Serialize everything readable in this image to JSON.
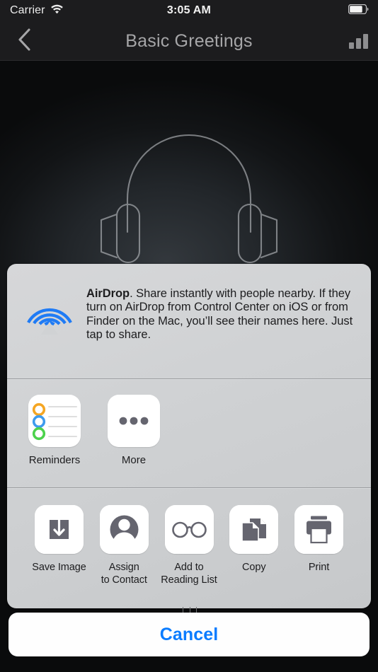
{
  "status_bar": {
    "carrier": "Carrier",
    "wifi_icon": "wifi-icon",
    "time": "3:05 AM",
    "battery_icon": "battery-icon",
    "battery_level_percent": 78
  },
  "nav_bar": {
    "back_icon": "chevron-left-icon",
    "title": "Basic Greetings",
    "signal_icon": "signal-bars-icon"
  },
  "artwork": {
    "illustration": "headphones-outline-illustration"
  },
  "share_sheet": {
    "airdrop": {
      "icon": "airdrop-icon",
      "title": "AirDrop",
      "body": ". Share instantly with people nearby. If they turn on AirDrop from Control Center on iOS or from Finder on the Mac, you’ll see their names here. Just tap to share."
    },
    "apps": [
      {
        "label": "Reminders",
        "icon": "reminders-app-icon"
      },
      {
        "label": "More",
        "icon": "more-dots-icon"
      }
    ],
    "actions": [
      {
        "label": "Save Image",
        "icon": "save-image-icon"
      },
      {
        "label": "Assign\nto Contact",
        "line1": "Assign",
        "line2": "to Contact",
        "icon": "assign-to-contact-icon"
      },
      {
        "label": "Add to\nReading List",
        "line1": "Add to",
        "line2": "Reading List",
        "icon": "glasses-icon"
      },
      {
        "label": "Copy",
        "line1": "Copy",
        "line2": "",
        "icon": "copy-icon"
      },
      {
        "label": "Print",
        "line1": "Print",
        "line2": "",
        "icon": "printer-icon"
      }
    ]
  },
  "cancel": {
    "label": "Cancel"
  },
  "colors": {
    "accent_blue": "#0a7cff",
    "airdrop_blue": "#1f7bf5",
    "sheet_background": "#d0d2d4",
    "nav_background": "#1c1c1e",
    "icon_gray": "#65656f",
    "reminders_orange": "#f5a623",
    "reminders_blue": "#3e9bee",
    "reminders_green": "#4cd24c"
  }
}
